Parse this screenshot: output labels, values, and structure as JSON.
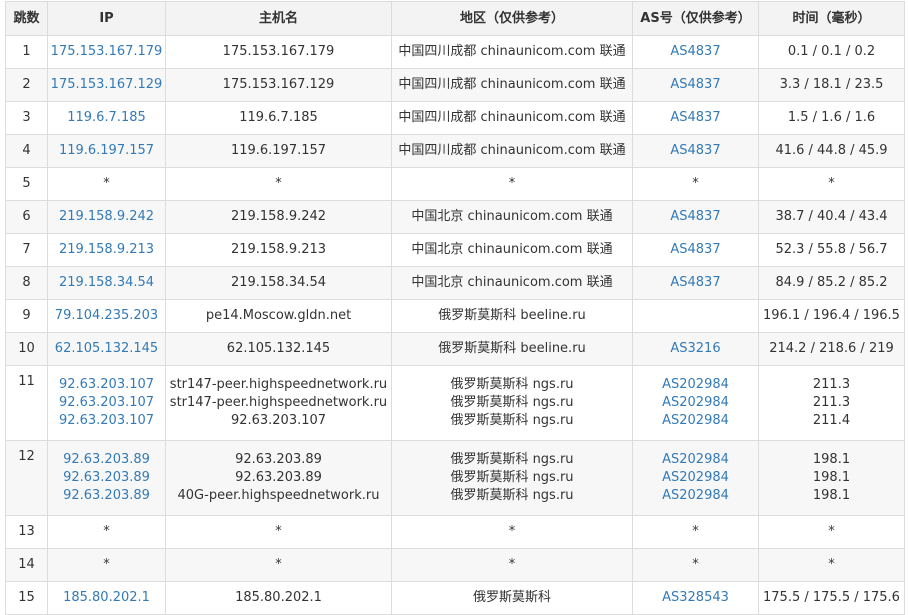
{
  "headers": [
    "跳数",
    "IP",
    "主机名",
    "地区（仅供参考）",
    "AS号（仅供参考）",
    "时间（毫秒）"
  ],
  "rows": [
    {
      "hop": "1",
      "ips": [
        "175.153.167.179"
      ],
      "hosts": [
        "175.153.167.179"
      ],
      "regions": [
        "中国四川成都 chinaunicom.com 联通"
      ],
      "as": [
        "AS4837"
      ],
      "times": [
        "0.1 / 0.1 / 0.2"
      ]
    },
    {
      "hop": "2",
      "ips": [
        "175.153.167.129"
      ],
      "hosts": [
        "175.153.167.129"
      ],
      "regions": [
        "中国四川成都 chinaunicom.com 联通"
      ],
      "as": [
        "AS4837"
      ],
      "times": [
        "3.3 / 18.1 / 23.5"
      ]
    },
    {
      "hop": "3",
      "ips": [
        "119.6.7.185"
      ],
      "hosts": [
        "119.6.7.185"
      ],
      "regions": [
        "中国四川成都 chinaunicom.com 联通"
      ],
      "as": [
        "AS4837"
      ],
      "times": [
        "1.5 / 1.6 / 1.6"
      ]
    },
    {
      "hop": "4",
      "ips": [
        "119.6.197.157"
      ],
      "hosts": [
        "119.6.197.157"
      ],
      "regions": [
        "中国四川成都 chinaunicom.com 联通"
      ],
      "as": [
        "AS4837"
      ],
      "times": [
        "41.6 / 44.8 / 45.9"
      ]
    },
    {
      "hop": "5",
      "ips": [
        "*"
      ],
      "hosts": [
        "*"
      ],
      "regions": [
        "*"
      ],
      "as": [
        "*"
      ],
      "times": [
        "*"
      ]
    },
    {
      "hop": "6",
      "ips": [
        "219.158.9.242"
      ],
      "hosts": [
        "219.158.9.242"
      ],
      "regions": [
        "中国北京 chinaunicom.com 联通"
      ],
      "as": [
        "AS4837"
      ],
      "times": [
        "38.7 / 40.4 / 43.4"
      ]
    },
    {
      "hop": "7",
      "ips": [
        "219.158.9.213"
      ],
      "hosts": [
        "219.158.9.213"
      ],
      "regions": [
        "中国北京 chinaunicom.com 联通"
      ],
      "as": [
        "AS4837"
      ],
      "times": [
        "52.3 / 55.8 / 56.7"
      ]
    },
    {
      "hop": "8",
      "ips": [
        "219.158.34.54"
      ],
      "hosts": [
        "219.158.34.54"
      ],
      "regions": [
        "中国北京 chinaunicom.com 联通"
      ],
      "as": [
        "AS4837"
      ],
      "times": [
        "84.9 / 85.2 / 85.2"
      ]
    },
    {
      "hop": "9",
      "ips": [
        "79.104.235.203"
      ],
      "hosts": [
        "pe14.Moscow.gldn.net"
      ],
      "regions": [
        "俄罗斯莫斯科 beeline.ru"
      ],
      "as": [
        ""
      ],
      "times": [
        "196.1 / 196.4 / 196.5"
      ]
    },
    {
      "hop": "10",
      "ips": [
        "62.105.132.145"
      ],
      "hosts": [
        "62.105.132.145"
      ],
      "regions": [
        "俄罗斯莫斯科 beeline.ru"
      ],
      "as": [
        "AS3216"
      ],
      "times": [
        "214.2 / 218.6 / 219"
      ]
    },
    {
      "hop": "11",
      "ips": [
        "92.63.203.107",
        "92.63.203.107",
        "92.63.203.107"
      ],
      "hosts": [
        "str147-peer.highspeednetwork.ru",
        "str147-peer.highspeednetwork.ru",
        "92.63.203.107"
      ],
      "regions": [
        "俄罗斯莫斯科 ngs.ru",
        "俄罗斯莫斯科 ngs.ru",
        "俄罗斯莫斯科 ngs.ru"
      ],
      "as": [
        "AS202984",
        "AS202984",
        "AS202984"
      ],
      "times": [
        "211.3",
        "211.3",
        "211.4"
      ]
    },
    {
      "hop": "12",
      "ips": [
        "92.63.203.89",
        "92.63.203.89",
        "92.63.203.89"
      ],
      "hosts": [
        "92.63.203.89",
        "92.63.203.89",
        "40G-peer.highspeednetwork.ru"
      ],
      "regions": [
        "俄罗斯莫斯科 ngs.ru",
        "俄罗斯莫斯科 ngs.ru",
        "俄罗斯莫斯科 ngs.ru"
      ],
      "as": [
        "AS202984",
        "AS202984",
        "AS202984"
      ],
      "times": [
        "198.1",
        "198.1",
        "198.1"
      ]
    },
    {
      "hop": "13",
      "ips": [
        "*"
      ],
      "hosts": [
        "*"
      ],
      "regions": [
        "*"
      ],
      "as": [
        "*"
      ],
      "times": [
        "*"
      ]
    },
    {
      "hop": "14",
      "ips": [
        "*"
      ],
      "hosts": [
        "*"
      ],
      "regions": [
        "*"
      ],
      "as": [
        "*"
      ],
      "times": [
        "*"
      ]
    },
    {
      "hop": "15",
      "ips": [
        "185.80.202.1"
      ],
      "hosts": [
        "185.80.202.1"
      ],
      "regions": [
        "俄罗斯莫斯科"
      ],
      "as": [
        "AS328543"
      ],
      "times": [
        "175.5 / 175.5 / 175.6"
      ]
    }
  ],
  "colors": {
    "link": "#337ab7",
    "text": "#333333",
    "header_bg": "#f3f3f3",
    "border": "#dcdcdc",
    "stripe": "#f7f7f7"
  }
}
